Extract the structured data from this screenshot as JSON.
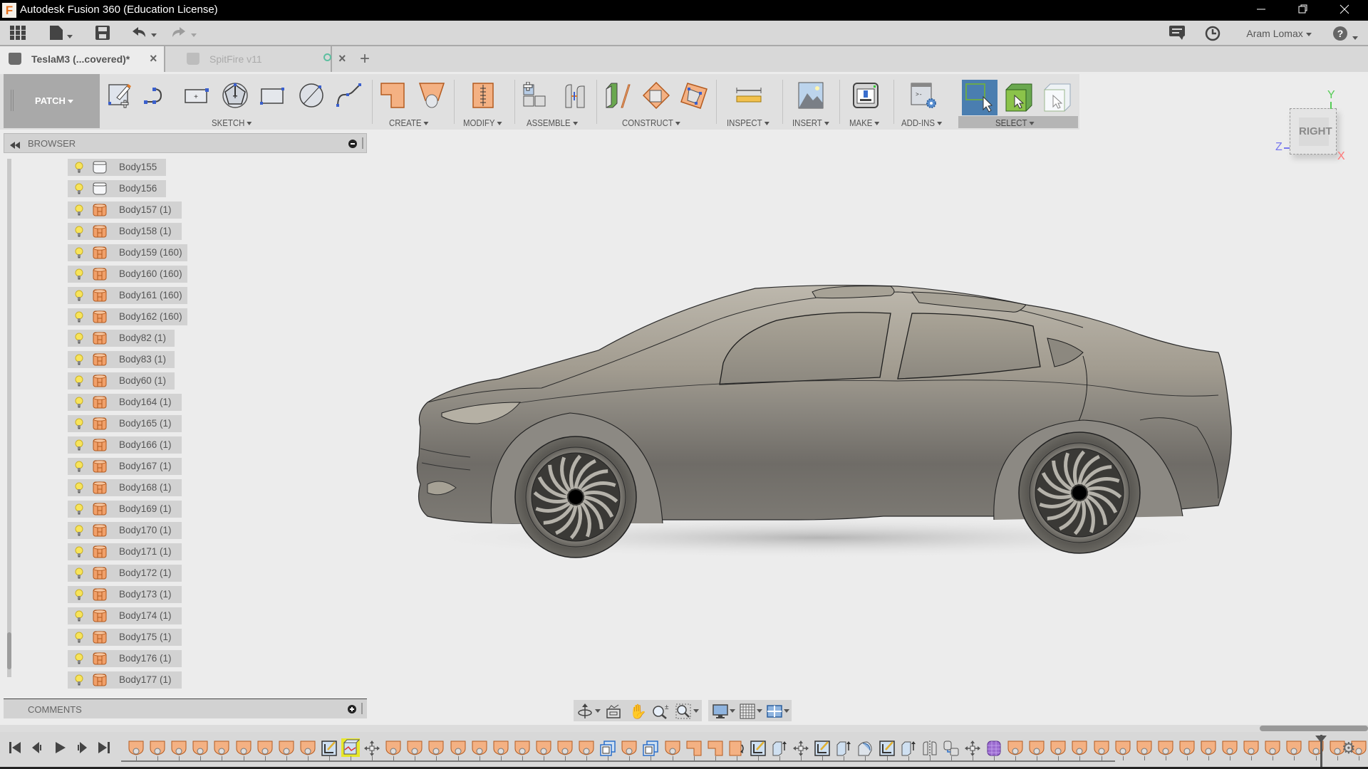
{
  "window": {
    "title": "Autodesk Fusion 360 (Education License)",
    "logo_letter": "F",
    "controls": [
      "minimize",
      "restore",
      "close"
    ]
  },
  "quick_access": {
    "user_name": "Aram Lomax",
    "icons": [
      "app-grid-icon",
      "file-icon",
      "save-icon",
      "undo-icon",
      "redo-icon",
      "job-status-icon",
      "history-clock-icon",
      "help-icon"
    ]
  },
  "tabs": [
    {
      "label": "TeslaM3 (...covered)*",
      "active": true
    },
    {
      "label": "SpitFire v11",
      "active": false,
      "status": "offline-sync"
    }
  ],
  "toolbar": {
    "workspace": "PATCH",
    "groups": [
      {
        "label": "SKETCH",
        "tools": [
          "create-sketch",
          "line",
          "rectangle-center",
          "polygon",
          "rectangle",
          "circle",
          "spline"
        ]
      },
      {
        "label": "CREATE",
        "tools": [
          "extrude-surface",
          "loft-surface"
        ]
      },
      {
        "label": "MODIFY",
        "tools": [
          "press-pull"
        ]
      },
      {
        "label": "ASSEMBLE",
        "tools": [
          "new-component",
          "joint"
        ]
      },
      {
        "label": "CONSTRUCT",
        "tools": [
          "offset-plane",
          "plane-at-angle",
          "plane-through-points"
        ]
      },
      {
        "label": "INSPECT",
        "tools": [
          "measure"
        ]
      },
      {
        "label": "INSERT",
        "tools": [
          "insert-canvas"
        ]
      },
      {
        "label": "MAKE",
        "tools": [
          "3d-print"
        ]
      },
      {
        "label": "ADD-INS",
        "tools": [
          "scripts-addins"
        ]
      },
      {
        "label": "SELECT",
        "tools": [
          "window-select",
          "select-body",
          "select-through"
        ],
        "active": true
      }
    ]
  },
  "viewcube": {
    "face": "RIGHT",
    "axes": {
      "x": "X",
      "y": "Y",
      "z": "Z"
    },
    "axis_colors": {
      "x": "#f07070",
      "y": "#50d050",
      "z": "#7070f0"
    }
  },
  "browser": {
    "title": "BROWSER",
    "items": [
      {
        "label": "Body155",
        "type": "surface-white"
      },
      {
        "label": "Body156",
        "type": "surface-white"
      },
      {
        "label": "Body157 (1)",
        "type": "body-orange"
      },
      {
        "label": "Body158 (1)",
        "type": "body-orange"
      },
      {
        "label": "Body159 (160)",
        "type": "body-orange"
      },
      {
        "label": "Body160 (160)",
        "type": "body-orange"
      },
      {
        "label": "Body161 (160)",
        "type": "body-orange"
      },
      {
        "label": "Body162 (160)",
        "type": "body-orange"
      },
      {
        "label": "Body82 (1)",
        "type": "body-orange"
      },
      {
        "label": "Body83 (1)",
        "type": "body-orange"
      },
      {
        "label": "Body60 (1)",
        "type": "body-orange"
      },
      {
        "label": "Body164 (1)",
        "type": "body-orange"
      },
      {
        "label": "Body165 (1)",
        "type": "body-orange"
      },
      {
        "label": "Body166 (1)",
        "type": "body-orange"
      },
      {
        "label": "Body167 (1)",
        "type": "body-orange"
      },
      {
        "label": "Body168 (1)",
        "type": "body-orange"
      },
      {
        "label": "Body169 (1)",
        "type": "body-orange"
      },
      {
        "label": "Body170 (1)",
        "type": "body-orange"
      },
      {
        "label": "Body171 (1)",
        "type": "body-orange"
      },
      {
        "label": "Body172 (1)",
        "type": "body-orange"
      },
      {
        "label": "Body173 (1)",
        "type": "body-orange"
      },
      {
        "label": "Body174 (1)",
        "type": "body-orange"
      },
      {
        "label": "Body175 (1)",
        "type": "body-orange"
      },
      {
        "label": "Body176 (1)",
        "type": "body-orange"
      },
      {
        "label": "Body177 (1)",
        "type": "body-orange"
      }
    ]
  },
  "comments": {
    "title": "COMMENTS"
  },
  "navbar": {
    "tools": [
      "orbit-icon",
      "look-at-icon",
      "pan-hand-icon",
      "zoom-icon",
      "fit-window-icon",
      "display-settings-icon",
      "grid-settings-icon",
      "viewports-icon"
    ]
  },
  "timeline": {
    "controls": [
      "go-to-start",
      "step-back",
      "play",
      "step-forward",
      "go-to-end"
    ],
    "features": [
      "loft",
      "loft",
      "loft",
      "loft",
      "loft",
      "loft",
      "loft",
      "loft",
      "loft",
      "sketch",
      "patch-highlighted",
      "move",
      "loft",
      "loft",
      "loft",
      "loft",
      "loft",
      "loft",
      "loft",
      "loft",
      "loft",
      "loft",
      "copy",
      "loft",
      "copy",
      "loft",
      "extrude",
      "extrude",
      "replace-face",
      "sketch",
      "extrude-up",
      "move",
      "sketch",
      "extrude-up",
      "revolve",
      "sketch",
      "extrude-up",
      "mirror",
      "combine",
      "move",
      "form",
      "loft",
      "loft",
      "loft",
      "loft",
      "loft",
      "loft",
      "loft",
      "loft",
      "loft",
      "loft",
      "loft",
      "loft",
      "loft",
      "loft",
      "loft",
      "loft",
      "loft"
    ],
    "highlighted_index": 10
  },
  "colors": {
    "accent_select": "#4a7eb0",
    "highlight_feature": "#e7e72a",
    "body_orange": "#e8803a"
  }
}
